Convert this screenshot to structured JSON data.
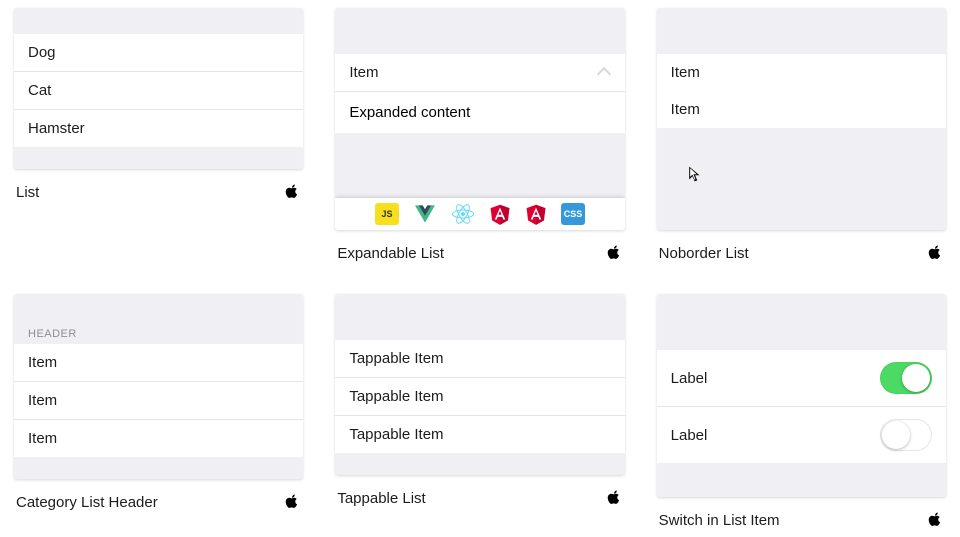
{
  "cards": {
    "list": {
      "caption": "List",
      "items": [
        "Dog",
        "Cat",
        "Hamster"
      ]
    },
    "expandable": {
      "caption": "Expandable List",
      "item": "Item",
      "content": "Expanded content"
    },
    "noborder": {
      "caption": "Noborder List",
      "items": [
        "Item",
        "Item"
      ]
    },
    "category": {
      "caption": "Category List Header",
      "header": "HEADER",
      "items": [
        "Item",
        "Item",
        "Item"
      ]
    },
    "tappable": {
      "caption": "Tappable List",
      "items": [
        "Tappable Item",
        "Tappable Item",
        "Tappable Item"
      ]
    },
    "switch": {
      "caption": "Switch in List Item",
      "rows": [
        {
          "label": "Label",
          "on": true
        },
        {
          "label": "Label",
          "on": false
        }
      ]
    }
  },
  "badges": {
    "js": "JS",
    "vue": "vue-icon",
    "react": "react-icon",
    "ang1": "A1",
    "ang2": "A2",
    "css": "CSS"
  }
}
